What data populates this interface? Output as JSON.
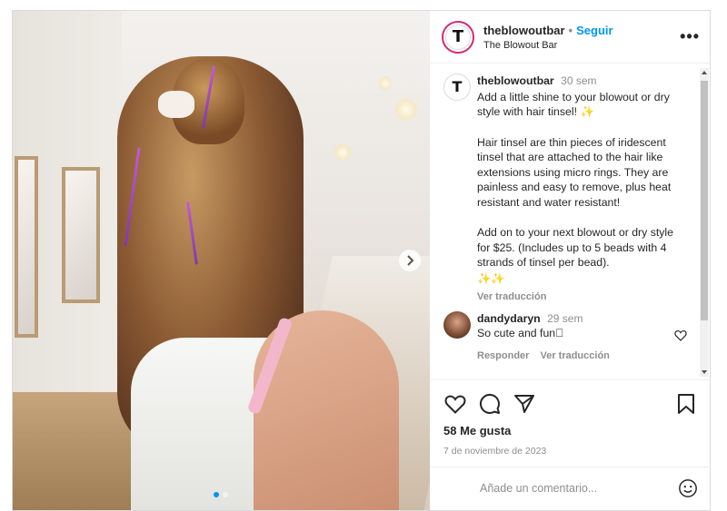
{
  "post": {
    "media": {
      "carousel_dots": 2,
      "active_dot": 0
    },
    "header": {
      "username": "theblowoutbar",
      "separator": "•",
      "follow_label": "Seguir",
      "subtitle": "The Blowout Bar",
      "more_label": "•••"
    },
    "caption": {
      "username": "theblowoutbar",
      "time": "30 sem",
      "paragraph1": "Add a little shine to your blowout or dry style with hair tinsel! ✨",
      "paragraph2": "Hair tinsel are thin pieces of iridescent tinsel that are attached to the hair like extensions using micro rings. They are painless and easy to remove, plus heat resistant and water resistant!",
      "paragraph3": "Add on to your next blowout or dry style for $25. (Includes up to 5 beads with 4 strands of tinsel per bead).",
      "paragraph3_emoji": "✨✨",
      "translate_label": "Ver traducción"
    },
    "comment": {
      "username": "dandydaryn",
      "time": "29 sem",
      "text": "So cute and fun􏿽",
      "reply_label": "Responder",
      "translate_label": "Ver traducción"
    },
    "actions": {
      "likes": "58 Me gusta",
      "date": "7 de noviembre de 2023",
      "icons": [
        "heart-icon",
        "comment-icon",
        "share-icon",
        "bookmark-icon"
      ]
    },
    "add_comment": {
      "placeholder": "Añade un comentario..."
    },
    "colors": {
      "accent": "#0095f6",
      "text": "#262626",
      "muted": "#8e8e8e"
    }
  }
}
